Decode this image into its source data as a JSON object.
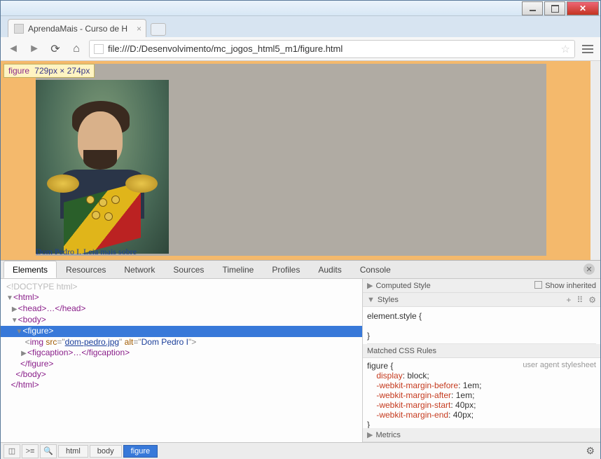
{
  "window": {
    "title": "AprendaMais - Curso de H"
  },
  "toolbar": {
    "url": "file:///D:/Desenvolvimento/mc_jogos_html5_m1/figure.html"
  },
  "viewport": {
    "tooltip_tag": "figure",
    "tooltip_dims": "729px × 274px",
    "caption": "Dom Pedro I. Leia mais sobre"
  },
  "devtools": {
    "tabs": [
      "Elements",
      "Resources",
      "Network",
      "Sources",
      "Timeline",
      "Profiles",
      "Audits",
      "Console"
    ],
    "active_tab": "Elements",
    "dom": {
      "doctype": "<!DOCTYPE html>",
      "html_open": "<html>",
      "head": "<head>…</head>",
      "body_open": "<body>",
      "figure_open": "<figure>",
      "img_src": "dom-pedro.jpg",
      "img_alt": "Dom Pedro I",
      "figcaption": "<figcaption>…</figcaption>",
      "figure_close": "</figure>",
      "body_close": "</body>",
      "html_close": "</html>"
    },
    "styles": {
      "computed_header": "Computed Style",
      "show_inherited": "Show inherited",
      "styles_header": "Styles",
      "element_style": "element.style {",
      "element_style_close": "}",
      "matched_header": "Matched CSS Rules",
      "ua_label": "user agent stylesheet",
      "selector": "figure {",
      "rules": [
        {
          "prop": "display",
          "val": "block;"
        },
        {
          "prop": "-webkit-margin-before",
          "val": "1em;"
        },
        {
          "prop": "-webkit-margin-after",
          "val": "1em;"
        },
        {
          "prop": "-webkit-margin-start",
          "val": "40px;"
        },
        {
          "prop": "-webkit-margin-end",
          "val": "40px;"
        }
      ],
      "selector_close": "}",
      "metrics_header": "Metrics"
    },
    "breadcrumbs": [
      "html",
      "body",
      "figure"
    ]
  }
}
